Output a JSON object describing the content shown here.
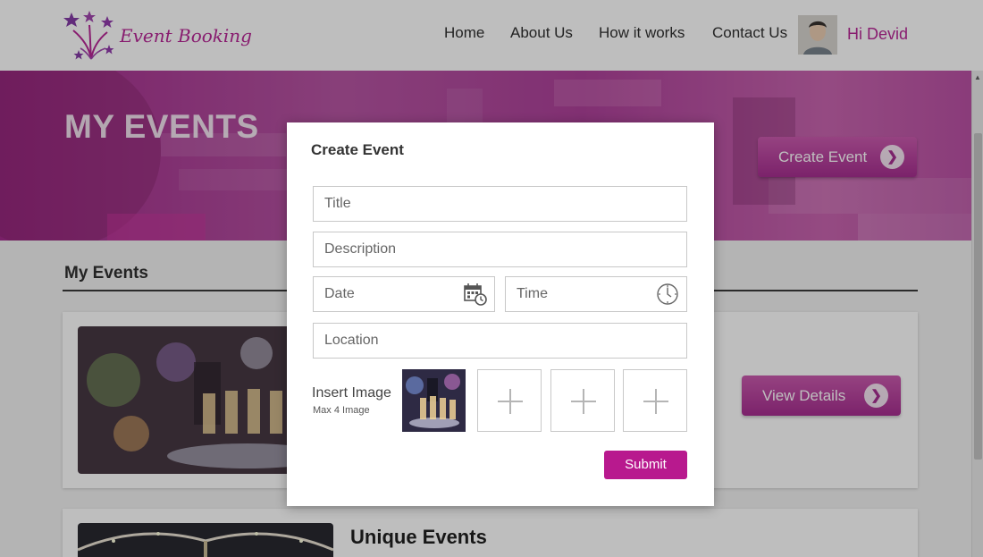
{
  "header": {
    "brand": "Event Booking",
    "nav": [
      "Home",
      "About Us",
      "How it works",
      "Contact Us"
    ],
    "greeting": "Hi Devid"
  },
  "hero": {
    "title": "MY EVENTS",
    "create_button": "Create Event"
  },
  "main": {
    "section_title": "My Events",
    "cards": [
      {
        "title": "",
        "button": "View Details"
      },
      {
        "title": "Unique Events"
      }
    ]
  },
  "modal": {
    "title": "Create Event",
    "fields": {
      "title_placeholder": "Title",
      "description_placeholder": "Description",
      "date_placeholder": "Date",
      "time_placeholder": "Time",
      "location_placeholder": "Location"
    },
    "insert_image_label": "Insert Image",
    "insert_image_hint": "Max 4 Image",
    "submit": "Submit"
  },
  "colors": {
    "accent": "#b2188f",
    "hero": "#a83493",
    "overlay": "rgba(40,40,40,0.30)"
  },
  "icons": [
    "logo-stars-icon",
    "chevron-right-icon",
    "calendar-clock-icon",
    "clock-icon",
    "plus-icon",
    "scroll-up-icon"
  ]
}
